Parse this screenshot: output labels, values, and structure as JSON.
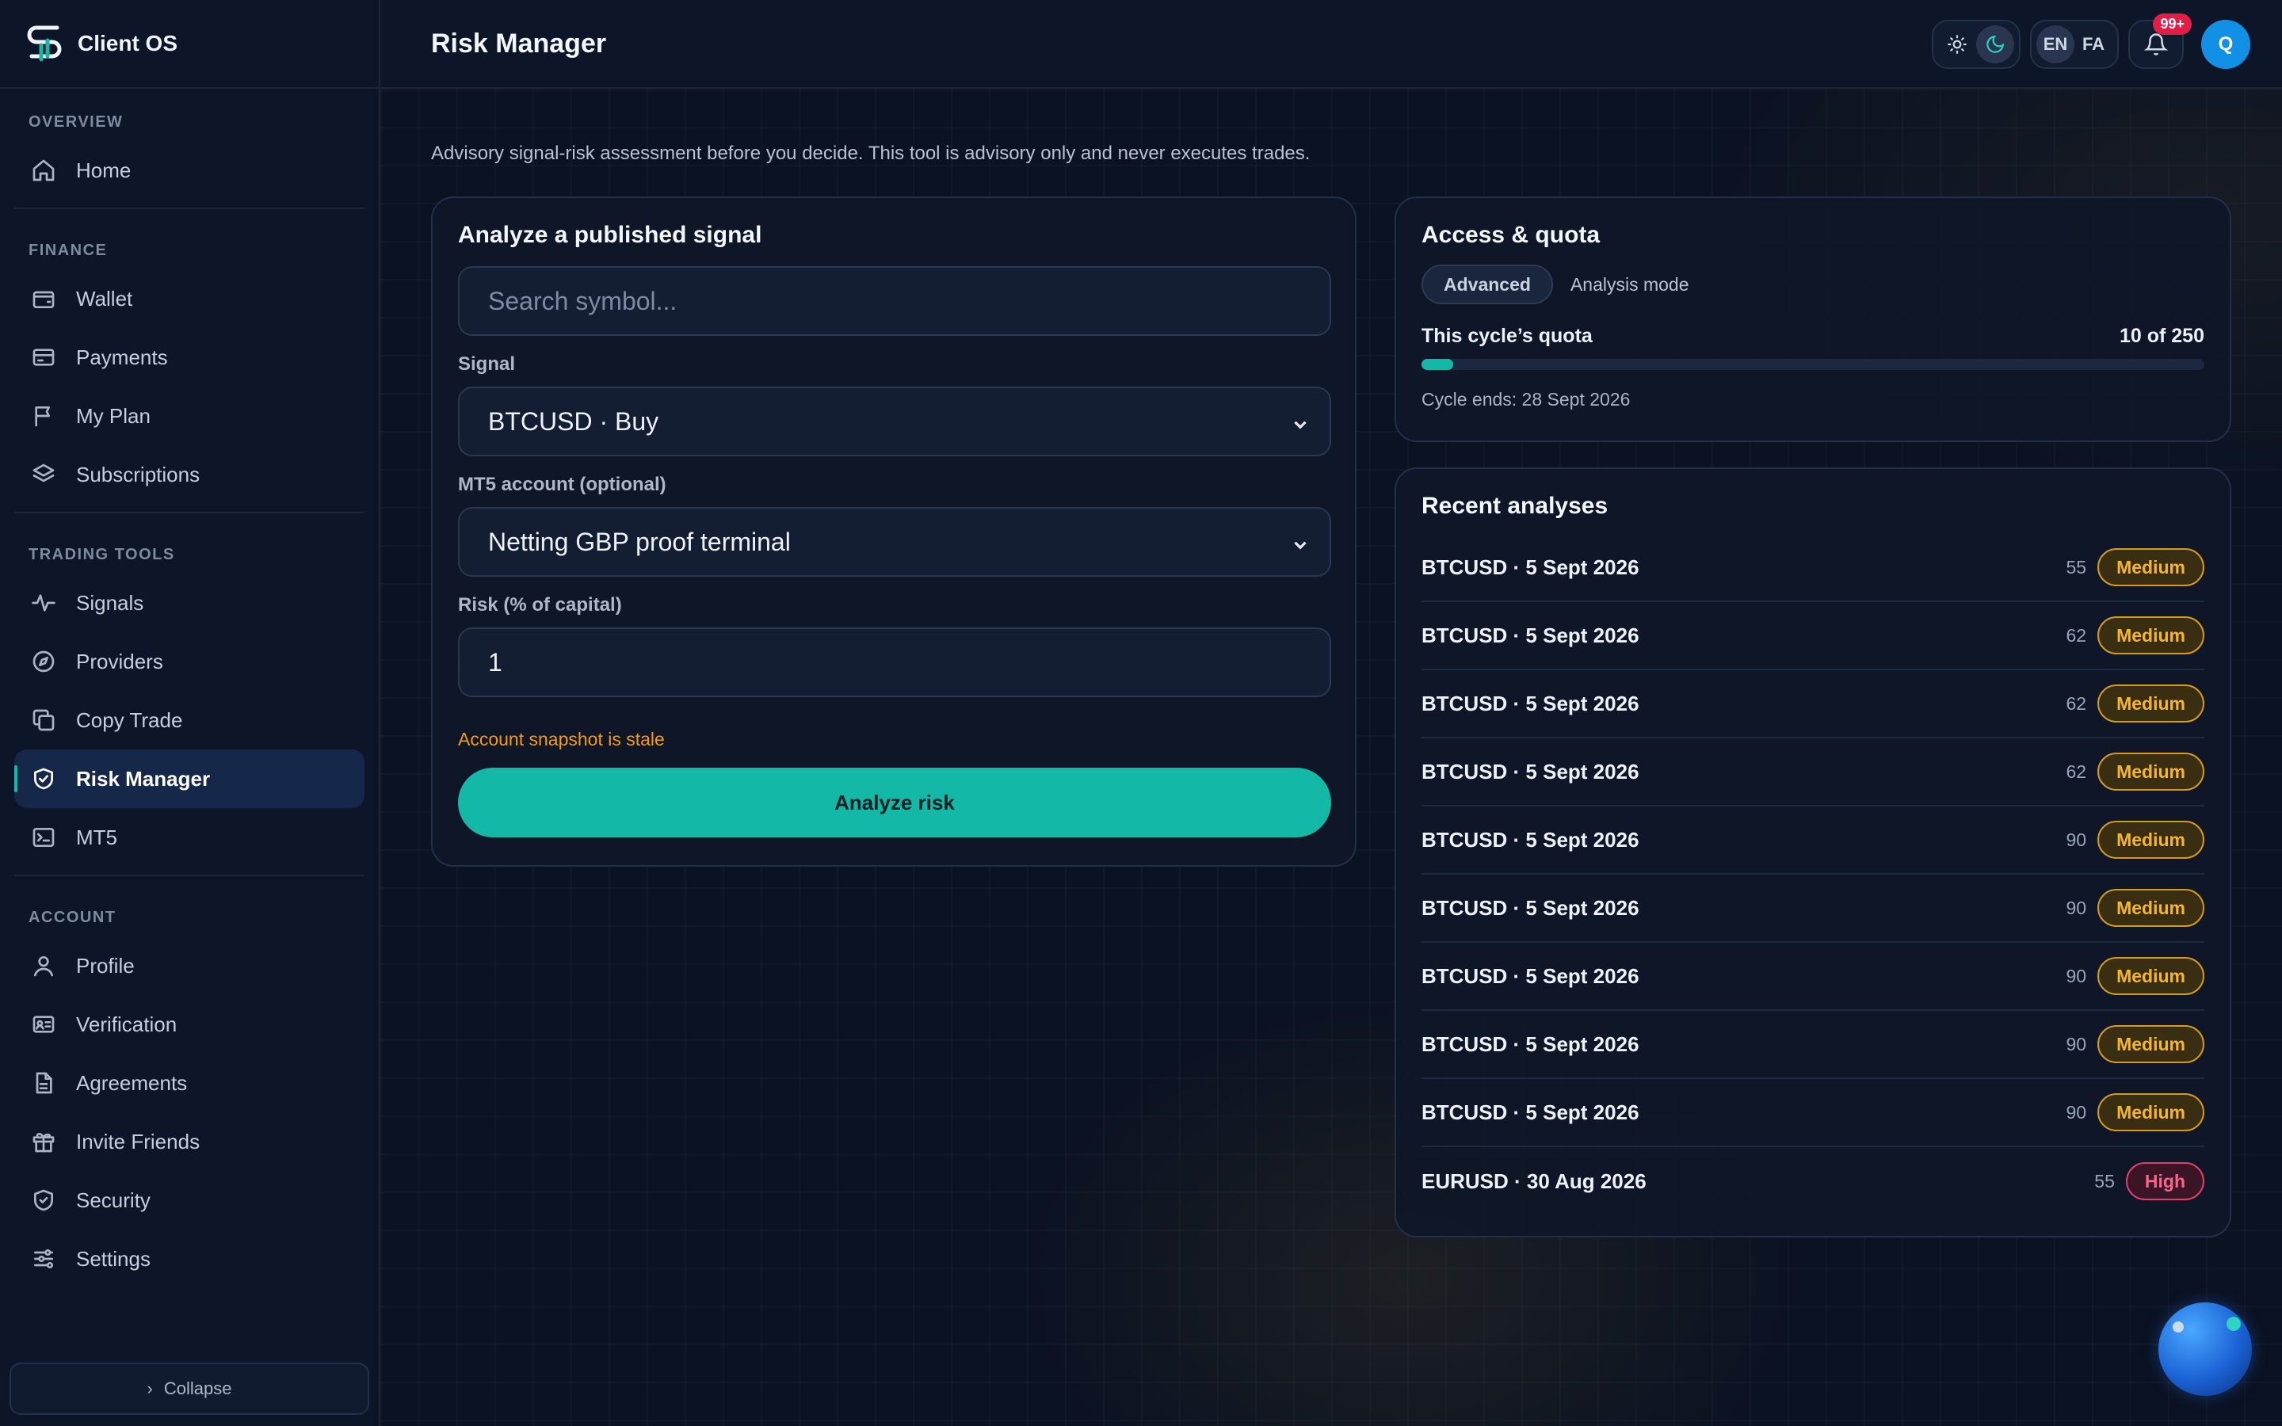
{
  "app": {
    "name": "Client OS"
  },
  "header": {
    "title": "Risk Manager",
    "lang_en": "EN",
    "lang_fa": "FA",
    "notifications_count": "99+",
    "avatar_initial": "Q"
  },
  "sidebar": {
    "sections": [
      {
        "title": "OVERVIEW",
        "items": [
          {
            "label": "Home",
            "icon": "home-icon"
          }
        ]
      },
      {
        "title": "FINANCE",
        "items": [
          {
            "label": "Wallet",
            "icon": "wallet-icon"
          },
          {
            "label": "Payments",
            "icon": "credit-card-icon"
          },
          {
            "label": "My Plan",
            "icon": "flag-icon"
          },
          {
            "label": "Subscriptions",
            "icon": "layers-icon"
          }
        ]
      },
      {
        "title": "TRADING TOOLS",
        "items": [
          {
            "label": "Signals",
            "icon": "activity-icon"
          },
          {
            "label": "Providers",
            "icon": "compass-icon"
          },
          {
            "label": "Copy Trade",
            "icon": "copy-icon"
          },
          {
            "label": "Risk Manager",
            "icon": "shield-check-icon",
            "active": true
          },
          {
            "label": "MT5",
            "icon": "terminal-icon"
          }
        ]
      },
      {
        "title": "ACCOUNT",
        "items": [
          {
            "label": "Profile",
            "icon": "user-icon"
          },
          {
            "label": "Verification",
            "icon": "id-card-icon"
          },
          {
            "label": "Agreements",
            "icon": "document-icon"
          },
          {
            "label": "Invite Friends",
            "icon": "gift-icon"
          },
          {
            "label": "Security",
            "icon": "shield-icon"
          },
          {
            "label": "Settings",
            "icon": "sliders-icon"
          }
        ]
      }
    ],
    "collapse_label": "Collapse"
  },
  "main": {
    "subtitle": "Advisory signal-risk assessment before you decide. This tool is advisory only and never executes trades.",
    "analyze": {
      "title": "Analyze a published signal",
      "search_placeholder": "Search symbol...",
      "signal_label": "Signal",
      "signal_value": "BTCUSD · Buy",
      "account_label": "MT5 account (optional)",
      "account_value": "Netting GBP proof terminal",
      "risk_label": "Risk (% of capital)",
      "risk_value": "1",
      "warning": "Account snapshot is stale",
      "button": "Analyze risk"
    },
    "quota": {
      "title": "Access & quota",
      "mode_chip": "Advanced",
      "mode_label": "Analysis mode",
      "quota_label": "This cycle’s quota",
      "quota_value": "10 of 250",
      "quota_fraction": 0.04,
      "cycle_ends": "Cycle ends: 28 Sept 2026"
    },
    "recent": {
      "title": "Recent analyses",
      "rows": [
        {
          "name": "BTCUSD · 5 Sept 2026",
          "score": "55",
          "level": "Medium"
        },
        {
          "name": "BTCUSD · 5 Sept 2026",
          "score": "62",
          "level": "Medium"
        },
        {
          "name": "BTCUSD · 5 Sept 2026",
          "score": "62",
          "level": "Medium"
        },
        {
          "name": "BTCUSD · 5 Sept 2026",
          "score": "62",
          "level": "Medium"
        },
        {
          "name": "BTCUSD · 5 Sept 2026",
          "score": "90",
          "level": "Medium"
        },
        {
          "name": "BTCUSD · 5 Sept 2026",
          "score": "90",
          "level": "Medium"
        },
        {
          "name": "BTCUSD · 5 Sept 2026",
          "score": "90",
          "level": "Medium"
        },
        {
          "name": "BTCUSD · 5 Sept 2026",
          "score": "90",
          "level": "Medium"
        },
        {
          "name": "BTCUSD · 5 Sept 2026",
          "score": "90",
          "level": "Medium"
        },
        {
          "name": "EURUSD · 30 Aug 2026",
          "score": "55",
          "level": "High"
        }
      ]
    }
  },
  "colors": {
    "accent": "#14b8a6",
    "medium": "#f5b62b",
    "high": "#f7668b",
    "notif": "#e11d48"
  }
}
